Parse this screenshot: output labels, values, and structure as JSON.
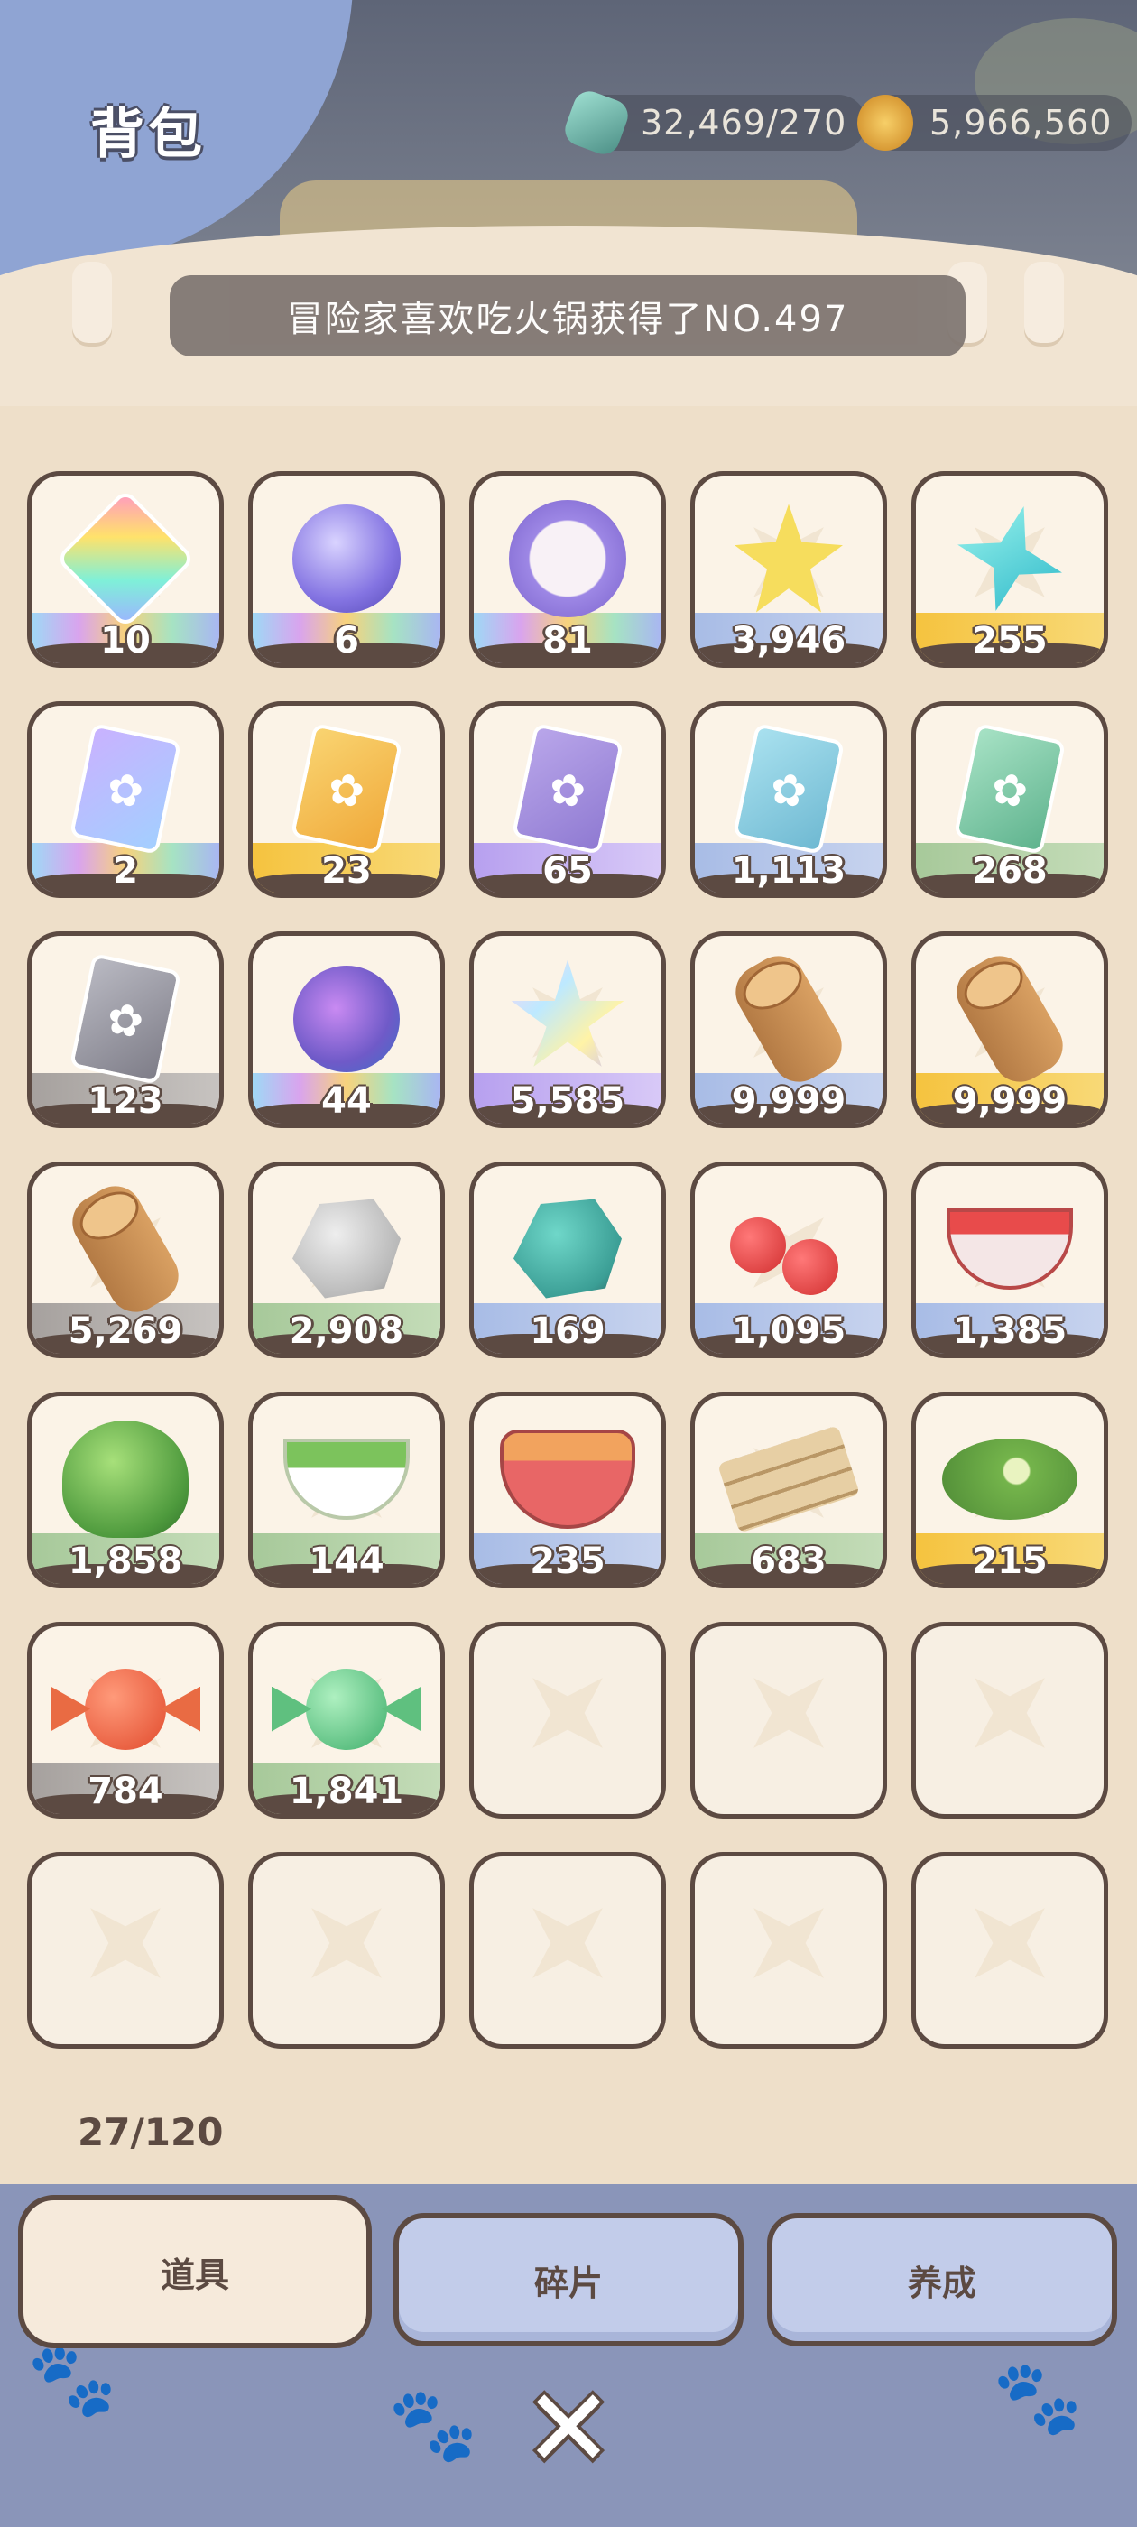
{
  "header": {
    "title": "背包",
    "energy": {
      "icon": "energy-crystal-icon",
      "value": "32,469/270"
    },
    "coins": {
      "icon": "gold-coin-icon",
      "value": "5,966,560"
    }
  },
  "marquee": {
    "text": "冒险家喜欢吃火锅获得了NO.497"
  },
  "inventory": {
    "capacity": "27/120",
    "items": [
      {
        "icon": "rainbow-gem-icon",
        "art": "gem",
        "rarity": "r-rainbow",
        "qty": "10"
      },
      {
        "icon": "crystal-ball-icon",
        "art": "orb",
        "rarity": "r-rainbow",
        "qty": "6"
      },
      {
        "icon": "cat-orb-icon",
        "art": "catball",
        "rarity": "r-rainbow",
        "qty": "81"
      },
      {
        "icon": "yellow-flower-icon",
        "art": "flower",
        "rarity": "r-blue",
        "qty": "3,946"
      },
      {
        "icon": "cyan-crystal-icon",
        "art": "crystal",
        "rarity": "r-gold",
        "qty": "255"
      },
      {
        "icon": "rainbow-card-icon",
        "art": "card card-rainbow",
        "rarity": "r-rainbow",
        "qty": "2"
      },
      {
        "icon": "gold-card-icon",
        "art": "card card-gold",
        "rarity": "r-gold",
        "qty": "23"
      },
      {
        "icon": "purple-card-icon",
        "art": "card card-purple",
        "rarity": "r-purple",
        "qty": "65"
      },
      {
        "icon": "blue-card-icon",
        "art": "card card-blue",
        "rarity": "r-blue",
        "qty": "1,113"
      },
      {
        "icon": "green-card-icon",
        "art": "card card-green",
        "rarity": "r-green",
        "qty": "268"
      },
      {
        "icon": "gray-card-icon",
        "art": "card card-gray",
        "rarity": "r-gray",
        "qty": "123"
      },
      {
        "icon": "magic-fruit-icon",
        "art": "fruit",
        "rarity": "r-rainbow",
        "qty": "44"
      },
      {
        "icon": "rainbow-star-icon",
        "art": "star",
        "rarity": "r-purple",
        "qty": "5,585"
      },
      {
        "icon": "wood-log-icon",
        "art": "log",
        "rarity": "r-blue",
        "qty": "9,999"
      },
      {
        "icon": "wood-log-icon",
        "art": "log",
        "rarity": "r-gold",
        "qty": "9,999"
      },
      {
        "icon": "wood-log-icon",
        "art": "log",
        "rarity": "r-gray",
        "qty": "5,269"
      },
      {
        "icon": "gray-stone-icon",
        "art": "rock",
        "rarity": "r-green",
        "qty": "2,908"
      },
      {
        "icon": "teal-ore-icon",
        "art": "rock-teal",
        "rarity": "r-blue",
        "qty": "169"
      },
      {
        "icon": "cherries-icon",
        "art": "cherry",
        "rarity": "r-blue",
        "qty": "1,095"
      },
      {
        "icon": "cherry-bowl-icon",
        "art": "bowl",
        "rarity": "r-blue",
        "qty": "1,385"
      },
      {
        "icon": "lettuce-icon",
        "art": "lettuce",
        "rarity": "r-green",
        "qty": "1,858"
      },
      {
        "icon": "salad-bowl-icon",
        "art": "salad",
        "rarity": "r-green",
        "qty": "144"
      },
      {
        "icon": "hotpot-bowl-icon",
        "art": "potbowl",
        "rarity": "r-blue",
        "qty": "235"
      },
      {
        "icon": "wood-planks-icon",
        "art": "planks",
        "rarity": "r-green",
        "qty": "683"
      },
      {
        "icon": "lily-pad-icon",
        "art": "leaf",
        "rarity": "r-gold",
        "qty": "215"
      },
      {
        "icon": "red-candy-icon",
        "art": "candy candy-red",
        "rarity": "r-gray",
        "qty": "784"
      },
      {
        "icon": "green-candy-icon",
        "art": "candy candy-green",
        "rarity": "r-green",
        "qty": "1,841"
      }
    ],
    "empty_slots": 8
  },
  "tabs": [
    {
      "label": "道具",
      "active": true
    },
    {
      "label": "碎片",
      "active": false
    },
    {
      "label": "养成",
      "active": false
    }
  ],
  "close": {
    "icon": "close-icon"
  }
}
